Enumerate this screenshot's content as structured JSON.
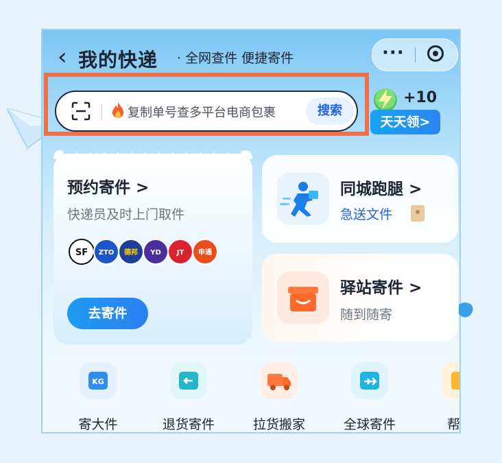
{
  "header": {
    "back_icon": "chevron-left-icon",
    "title": "我的快递",
    "subtitle": "全网查件 便捷寄件",
    "capsule": {
      "more_icon": "more-dots-icon",
      "target_icon": "close-target-icon"
    }
  },
  "search": {
    "scan_icon": "scan-icon",
    "fire_icon": "fire-icon",
    "placeholder": "复制单号查多平台电商包裹",
    "button_label": "搜索"
  },
  "reward": {
    "points": "+10",
    "label": "天天领>"
  },
  "cards": {
    "send": {
      "title": "预约寄件 >",
      "subtitle": "快递员及时上门取件",
      "logos": [
        "SF",
        "ZTO",
        "德邦",
        "YD",
        "JT",
        "申通"
      ],
      "button_label": "去寄件"
    },
    "errand": {
      "title": "同城跑腿 >",
      "subtitle": "急送文件"
    },
    "station": {
      "title": "驿站寄件 >",
      "subtitle": "随到随寄"
    }
  },
  "nav": [
    {
      "label": "寄大件",
      "icon": "kg-box-icon"
    },
    {
      "label": "退货寄件",
      "icon": "return-box-icon"
    },
    {
      "label": "拉货搬家",
      "icon": "truck-icon"
    },
    {
      "label": "全球寄件",
      "icon": "plane-icon"
    },
    {
      "label": "帮我",
      "icon": "help-icon"
    }
  ],
  "colors": {
    "accent": "#1f63e0",
    "highlight_border": "#f0704a",
    "background": "#e6f3fd"
  }
}
